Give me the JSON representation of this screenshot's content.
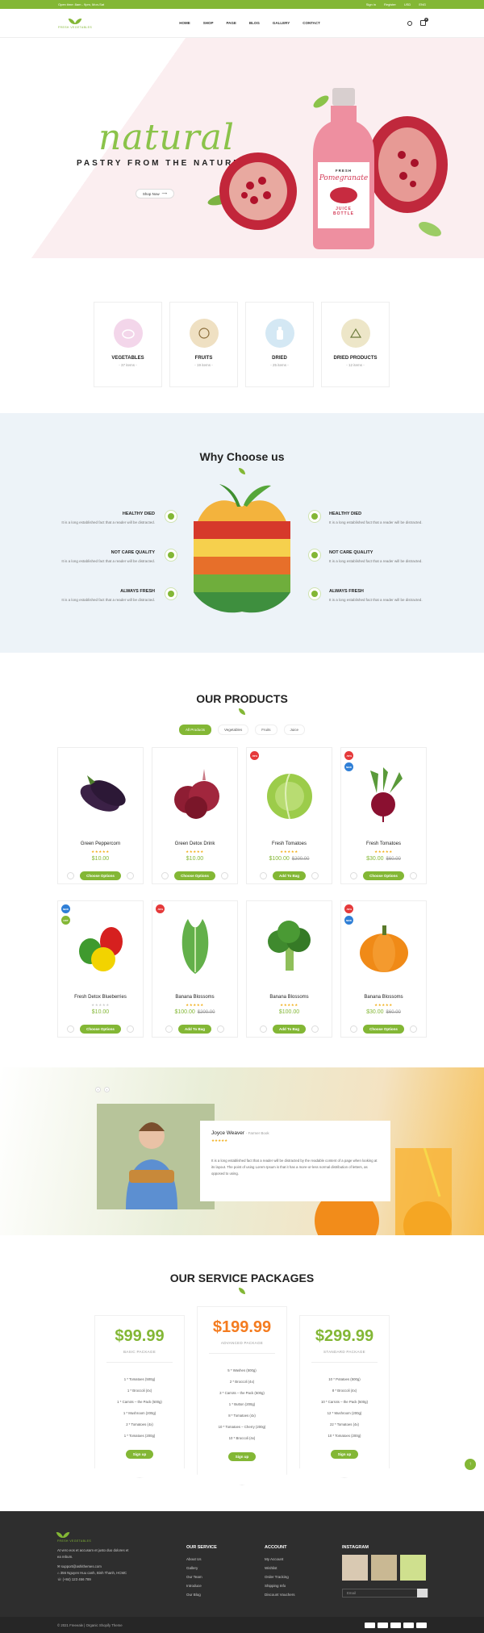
{
  "topbar": {
    "hours": "Open time: 8am - 9pm, Mon-Sat",
    "sign_in": "Sign in",
    "register": "Register",
    "currency": "USD",
    "language": "ENG"
  },
  "header": {
    "logo_text": "FRESH VEGETABLES",
    "nav": [
      "HOME",
      "SHOP",
      "PAGE",
      "BLOG",
      "GALLERY",
      "CONTACT"
    ],
    "cart_count": "0"
  },
  "hero": {
    "script_title": "natural",
    "subtitle": "PASTRY FROM THE NATURE",
    "cta": "Shop Now",
    "bottle_top": "FRESH",
    "bottle_name": "Pomegranate",
    "bottle_bottom1": "JUICE",
    "bottle_bottom2": "BOTTLE"
  },
  "categories": [
    {
      "name": "VEGETABLES",
      "count": "- 37 items -",
      "color": "#f3d6ea"
    },
    {
      "name": "FRUITS",
      "count": "- 19 items -",
      "color": "#efe0c2"
    },
    {
      "name": "DRIED",
      "count": "- 25 items -",
      "color": "#d4e8f4"
    },
    {
      "name": "DRIED PRODUCTS",
      "count": "- 12 items -",
      "color": "#ede6c8"
    }
  ],
  "why": {
    "title": "Why Choose us",
    "features": [
      {
        "title": "HEALTHY DIED",
        "desc": "It is a long established fact that a reader will be distracted."
      },
      {
        "title": "NOT CARE QUALITY",
        "desc": "It is a long established fact that a reader will be distracted."
      },
      {
        "title": "ALWAYS FRESH",
        "desc": "It is a long established fact that a reader will be distracted."
      }
    ]
  },
  "products": {
    "title": "OUR PRODUCTS",
    "tabs": [
      "All Products",
      "Vegetables",
      "Fruits",
      "Juice"
    ],
    "items": [
      {
        "name": "Green Peppercorn",
        "price": "$10.00",
        "old": "",
        "btn": "Choose Options",
        "badges": []
      },
      {
        "name": "Green Detox Drink",
        "price": "$10.00",
        "old": "",
        "btn": "Choose Options",
        "badges": []
      },
      {
        "name": "Fresh Tomatoes",
        "price": "$100.00",
        "old": "$200.00",
        "btn": "Add To Bag",
        "badges": [
          "-50%"
        ]
      },
      {
        "name": "Fresh Tomatoes",
        "price": "$30.00",
        "old": "$60.00",
        "btn": "Choose Options",
        "badges": [
          "-50%",
          "NEW"
        ]
      },
      {
        "name": "Fresh Detox Blueberries",
        "price": "$10.00",
        "old": "",
        "btn": "Choose Options",
        "badges": [
          "NEW",
          "HOT"
        ]
      },
      {
        "name": "Banana Blossoms",
        "price": "$100.00",
        "old": "$200.00",
        "btn": "Add To Bag",
        "badges": [
          "-50%"
        ]
      },
      {
        "name": "Banana Blossoms",
        "price": "$100.00",
        "old": "",
        "btn": "Add To Bag",
        "badges": []
      },
      {
        "name": "Banana Blossoms",
        "price": "$30.00",
        "old": "$60.00",
        "btn": "Choose Options",
        "badges": [
          "-50%",
          "NEW"
        ]
      }
    ]
  },
  "testimonial": {
    "name": "Joyce Weaver",
    "role": "- Farmer Book",
    "quote": "It is a long established fact that a reader will be distracted by the readable content of a page when looking at its layout. The point of using Lorem Ipsum is that it has a more-or-less normal distribution of letters, as opposed to using."
  },
  "packages": {
    "title": "OUR SERVICE PACKAGES",
    "plans": [
      {
        "price": "$99.99",
        "name": "BASIC PACKAGE",
        "btn": "Sign up",
        "items": [
          "1 * Tomatoes (500g)",
          "1 * Broccoli (4x)",
          "1 * Carrots – the Pack (500g)",
          "1 * Mushroom (200g)",
          "2 * Tomatoes (4x)",
          "1 * Tomatoes (200g)"
        ]
      },
      {
        "price": "$199.99",
        "name": "ADVANCED PACKAGE",
        "btn": "Sign up",
        "items": [
          "5 * Washes (500g)",
          "2 * Broccoli (4x)",
          "3 * Carrots – the Pack (500g)",
          "1 * Button (200g)",
          "8 * Tomatoes (4x)",
          "10 * Tomatoes – Cherry (200g)",
          "10 * Broccoli (4x)"
        ]
      },
      {
        "price": "$299.99",
        "name": "STANDARD PACKAGE",
        "btn": "Sign up",
        "items": [
          "10 * Potatoes (500g)",
          "8 * Broccoli (4x)",
          "10 * Carrots – the Pack (500g)",
          "12 * Mushroom (200g)",
          "22 * Tomatoes (4x)",
          "10 * Tomatoes (200g)"
        ]
      }
    ]
  },
  "footer": {
    "logo_text": "FRESH VEGETABLES",
    "about": "At vero eos et accusam et justo duo dolores et ea rebum.",
    "email": "support@ashithemes.com",
    "address": "356 Nguyen Huu canh, Binh Thanh, HCMC",
    "phone": "(+84) 123 456 789",
    "col1_title": "OUR SERVICE",
    "col1": [
      "About Us",
      "Gallery",
      "Our Team",
      "Introduce",
      "Our Blog"
    ],
    "col2_title": "ACCOUNT",
    "col2": [
      "My Account",
      "Wishlist",
      "Order Tracking",
      "Shipping Info",
      "Discount Vouchers"
    ],
    "col3_title": "INSTAGRAM",
    "email_placeholder": "Email",
    "copyright": "© 2021 Freeeale | Organic Shopify Theme"
  }
}
